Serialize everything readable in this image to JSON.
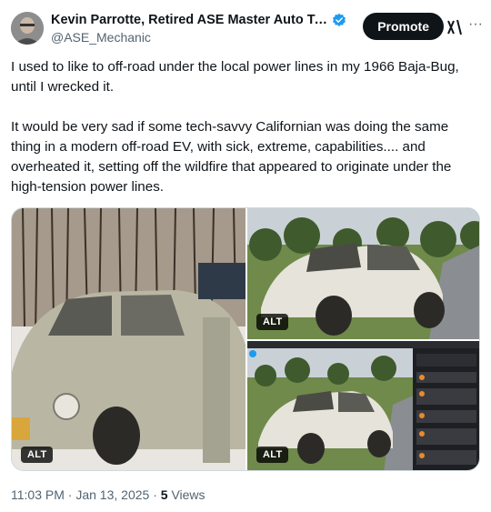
{
  "author": {
    "display_name": "Kevin Parrotte, Retired ASE Master Auto Tech...",
    "handle": "@ASE_Mechanic",
    "verified": true
  },
  "actions": {
    "promote_label": "Promote"
  },
  "tweet": {
    "paragraphs": [
      "I used to like to off-road under the local power lines in my 1966 Baja-Bug, until I wrecked it.",
      "It would be very sad if some tech-savvy Californian was doing the same thing in a modern off-road EV, with sick, extreme, capabilities.... and overheated it, setting off the wildfire that appeared to originate under the high-tension power lines."
    ]
  },
  "media": [
    {
      "alt_label": "ALT",
      "subject": "vintage VW beetle in snow"
    },
    {
      "alt_label": "ALT",
      "subject": "wrecked VW beetle in grass"
    },
    {
      "alt_label": "ALT",
      "subject": "screenshot of wrecked VW beetle with chat sidebar"
    }
  ],
  "meta": {
    "time": "11:03 PM",
    "separator": "·",
    "date": "Jan 13, 2025",
    "views_count": "5",
    "views_label": "Views"
  },
  "icons": {
    "verified": "verified-badge-icon",
    "grok": "grok-icon",
    "more": "more-icon"
  },
  "colors": {
    "verified_blue": "#1d9bf0",
    "promote_bg": "#0f1419",
    "secondary_text": "#536471"
  }
}
